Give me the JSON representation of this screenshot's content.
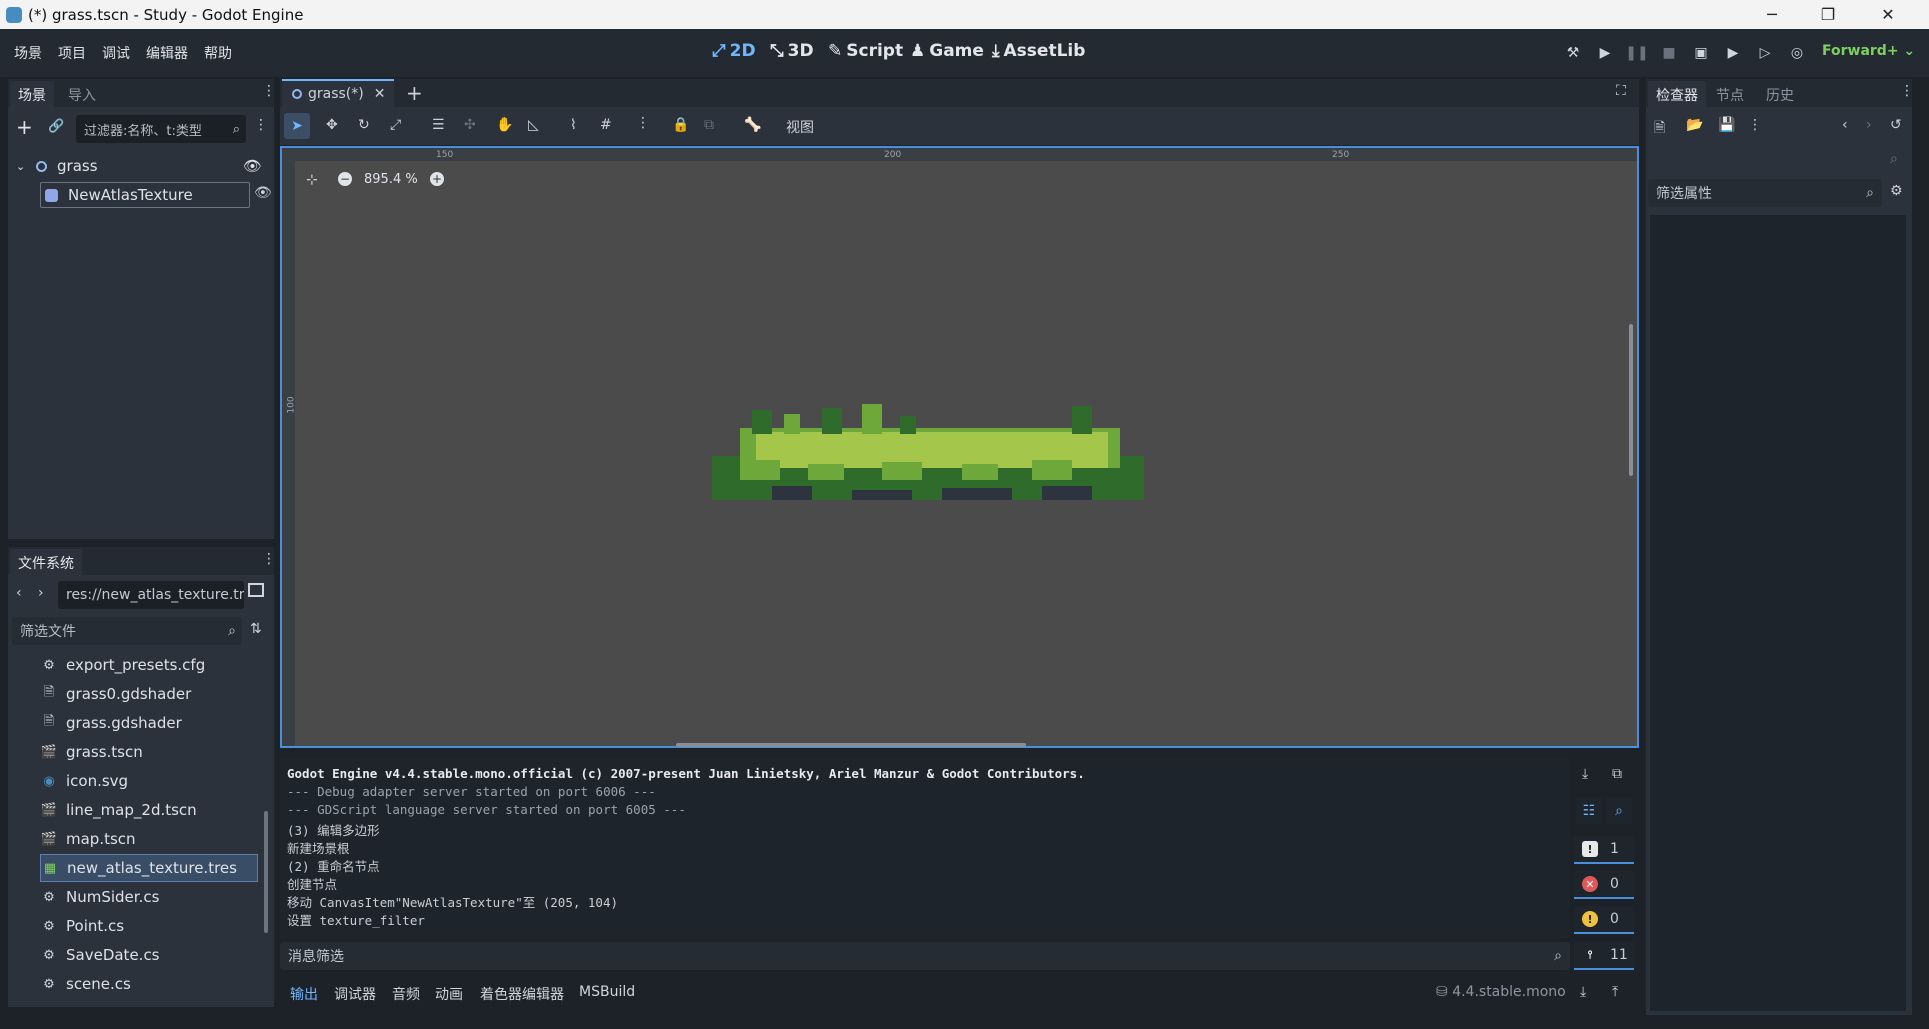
{
  "window": {
    "title": "(*) grass.tscn - Study - Godot Engine",
    "min_glyph": "─",
    "max_glyph": "❐",
    "close_glyph": "✕"
  },
  "menu": {
    "items": [
      "场景",
      "项目",
      "调试",
      "编辑器",
      "帮助"
    ]
  },
  "workspaces": {
    "items": [
      "2D",
      "3D",
      "Script",
      "Game",
      "AssetLib"
    ],
    "active": "2D"
  },
  "renderer": "Forward+",
  "scene_dock": {
    "tabs": [
      "场景",
      "导入"
    ],
    "filter_placeholder": "过滤器:名称、t:类型",
    "nodes": [
      {
        "name": "grass",
        "icon": "node2d-icon"
      },
      {
        "name": "NewAtlasTexture",
        "icon": "sprite-icon"
      }
    ]
  },
  "filesystem": {
    "tab": "文件系统",
    "path": "res://new_atlas_texture.tr",
    "filter_placeholder": "筛选文件",
    "files": [
      {
        "name": "export_presets.cfg",
        "icon": "gear-icon"
      },
      {
        "name": "grass0.gdshader",
        "icon": "file-icon"
      },
      {
        "name": "grass.gdshader",
        "icon": "file-icon"
      },
      {
        "name": "grass.tscn",
        "icon": "scene-icon"
      },
      {
        "name": "icon.svg",
        "icon": "image-icon"
      },
      {
        "name": "line_map_2d.tscn",
        "icon": "scene-icon"
      },
      {
        "name": "map.tscn",
        "icon": "scene-icon"
      },
      {
        "name": "new_atlas_texture.tres",
        "icon": "texture-icon"
      },
      {
        "name": "NumSider.cs",
        "icon": "gear-icon"
      },
      {
        "name": "Point.cs",
        "icon": "gear-icon"
      },
      {
        "name": "SaveDate.cs",
        "icon": "gear-icon"
      },
      {
        "name": "scene.cs",
        "icon": "gear-icon"
      }
    ],
    "selected": "new_atlas_texture.tres"
  },
  "editor": {
    "scene_tab": "grass(*)",
    "view_menu": "视图",
    "zoom": "895.4 %",
    "ruler": [
      "150",
      "200",
      "250"
    ],
    "ruler_v": "100"
  },
  "output": {
    "lines": [
      "Godot Engine v4.4.stable.mono.official (c) 2007-present Juan Linietsky, Ariel Manzur & Godot Contributors.",
      "--- Debug adapter server started on port 6006 ---",
      "--- GDScript language server started on port 6005 ---",
      "(3) 编辑多边形",
      "新建场景根",
      "(2) 重命名节点",
      "创建节点",
      "移动 CanvasItem\"NewAtlasTexture\"至 (205, 104)",
      "设置 texture_filter"
    ],
    "filter_placeholder": "消息筛选",
    "counts": {
      "messages": "1",
      "errors": "0",
      "warnings": "0",
      "editor": "11"
    }
  },
  "bottom_tabs": {
    "items": [
      "输出",
      "调试器",
      "音频",
      "动画",
      "着色器编辑器",
      "MSBuild"
    ],
    "active": "输出"
  },
  "version": "4.4.stable.mono",
  "inspector": {
    "tabs": [
      "检查器",
      "节点",
      "历史"
    ],
    "filter_placeholder": "筛选属性"
  },
  "colors": {
    "accent": "#6fb7ff",
    "grass_light": "#a4c64a",
    "grass_mid": "#6ea83a",
    "grass_dark": "#2f6b2a",
    "soil": "#2e3340"
  }
}
